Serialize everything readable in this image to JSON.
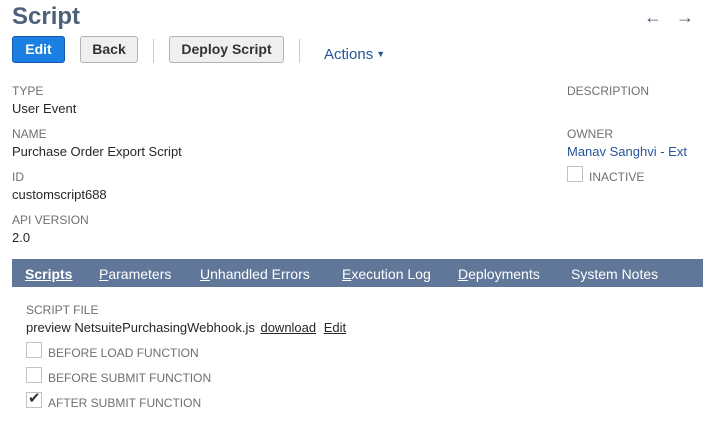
{
  "page": {
    "title": "Script"
  },
  "toolbar": {
    "edit_label": "Edit",
    "back_label": "Back",
    "deploy_label": "Deploy Script",
    "actions_label": "Actions"
  },
  "fields": {
    "type": {
      "label": "TYPE",
      "value": "User Event"
    },
    "name": {
      "label": "NAME",
      "value": "Purchase Order Export Script"
    },
    "id": {
      "label": "ID",
      "value": "customscript688"
    },
    "api_version": {
      "label": "API VERSION",
      "value": "2.0"
    },
    "description": {
      "label": "DESCRIPTION",
      "value": ""
    },
    "owner": {
      "label": "OWNER",
      "value": "Manav Sanghvi - Ext"
    },
    "inactive": {
      "label": "INACTIVE",
      "checked": false
    }
  },
  "tabs": [
    {
      "first": "S",
      "rest": "cripts",
      "active": true
    },
    {
      "first": "P",
      "rest": "arameters",
      "active": false
    },
    {
      "first": "U",
      "rest": "nhandled Errors",
      "active": false
    },
    {
      "first": "E",
      "rest": "xecution Log",
      "active": false
    },
    {
      "first": "D",
      "rest": "eployments",
      "active": false
    },
    {
      "first": "",
      "rest": "System Notes",
      "active": false
    }
  ],
  "scripts_tab": {
    "script_file_label": "SCRIPT FILE",
    "file_prefix": "preview",
    "file_name": "NetsuitePurchasingWebhook.js",
    "download_label": "download",
    "edit_label": "Edit",
    "before_load": {
      "label": "BEFORE LOAD FUNCTION",
      "checked": false
    },
    "before_submit": {
      "label": "BEFORE SUBMIT FUNCTION",
      "checked": false
    },
    "after_submit": {
      "label": "AFTER SUBMIT FUNCTION",
      "checked": true
    }
  },
  "icons": {
    "back_arrow": "arrow-left-icon",
    "forward_arrow": "arrow-right-icon",
    "actions_caret": "caret-down-icon",
    "checkmark": "checkmark-icon"
  },
  "colors": {
    "primary_button": "#1a7fe0",
    "title": "#4d5f79",
    "link": "#255599",
    "tab_bar": "#607799"
  }
}
